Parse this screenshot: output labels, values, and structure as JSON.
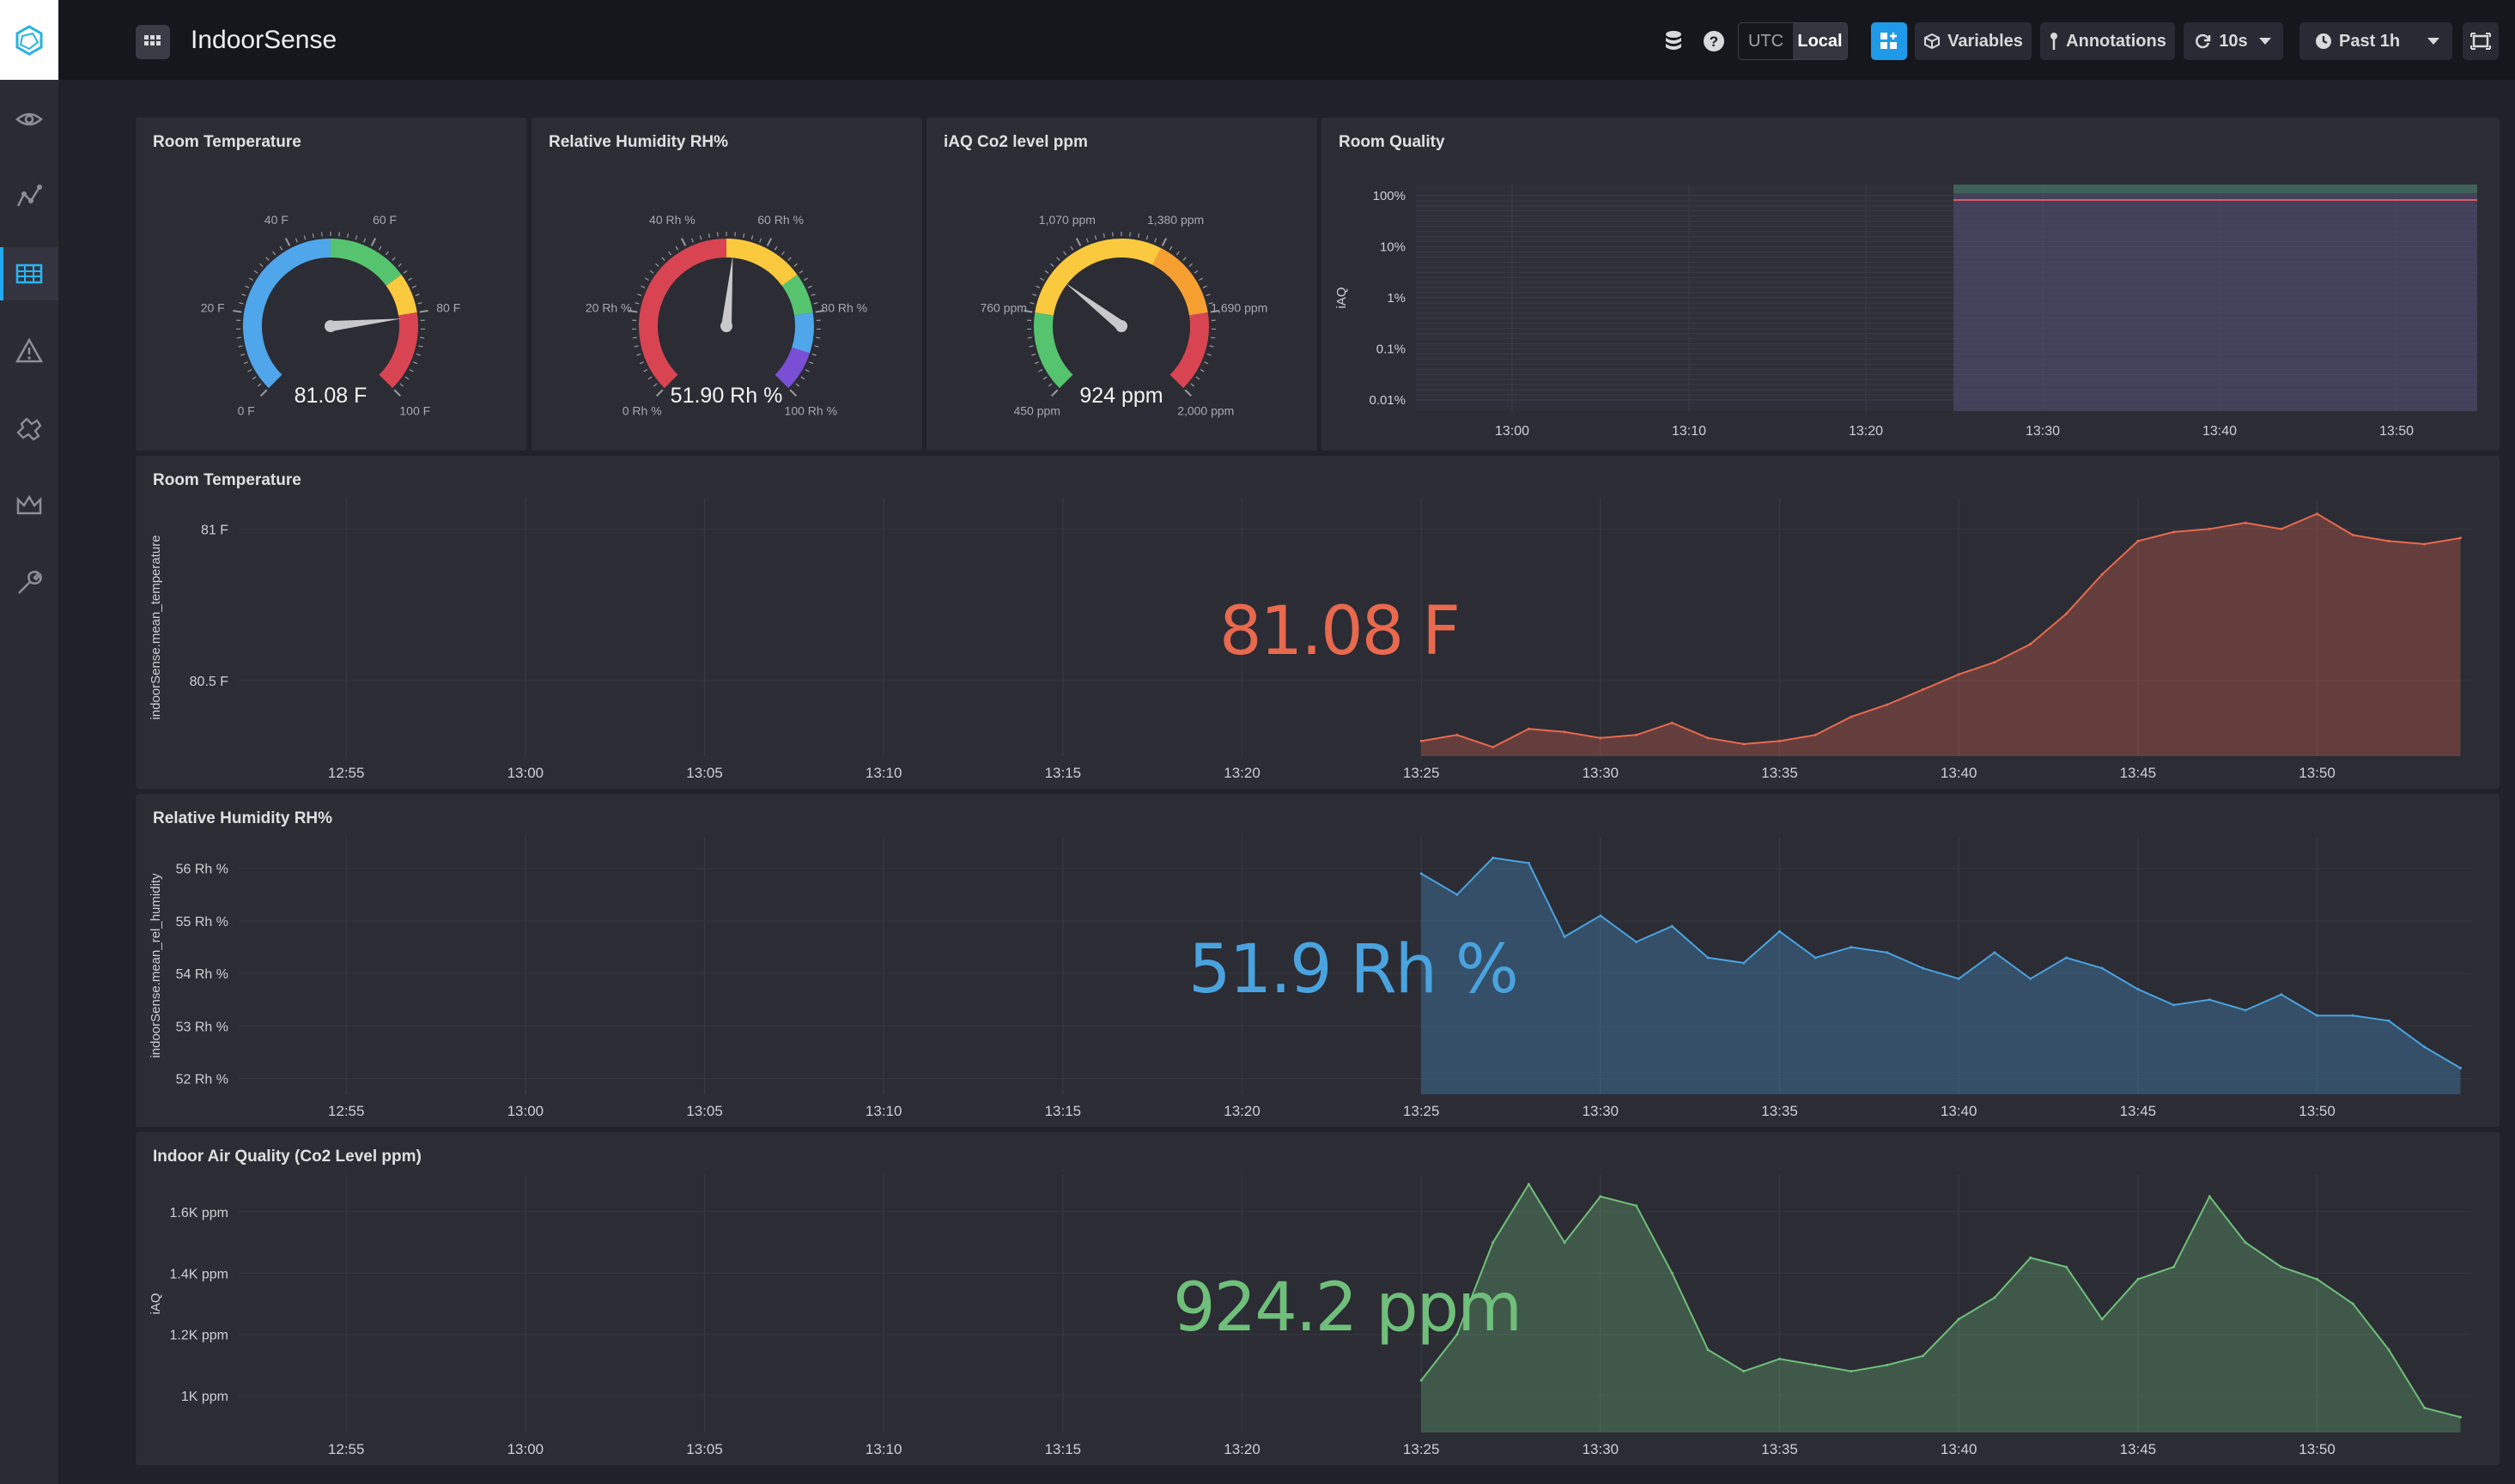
{
  "app": {
    "title": "IndoorSense"
  },
  "toolbar": {
    "utc": "UTC",
    "local": "Local",
    "variables": "Variables",
    "annotations": "Annotations",
    "refresh": "10s",
    "time_range": "Past 1h"
  },
  "sidebar": {
    "items": [
      {
        "icon": "eye-icon"
      },
      {
        "icon": "graph-icon"
      },
      {
        "icon": "dashboard-grid-icon",
        "active": true
      },
      {
        "icon": "alert-icon"
      },
      {
        "icon": "plugins-icon"
      },
      {
        "icon": "crown-icon"
      },
      {
        "icon": "wrench-icon"
      }
    ]
  },
  "colors": {
    "green": "#56c46f",
    "blue": "#4fa6ea",
    "yellow": "#fbc93d",
    "orange": "#f6a032",
    "red": "#d94452",
    "purple": "#7a4fd6",
    "temp_series": "#e8694e",
    "hum_series": "#4aa3df",
    "iaq_series": "#6fbf7a"
  },
  "gauges": [
    {
      "title": "Room Temperature",
      "value": "81.08 F",
      "min": 0,
      "max": 100,
      "needle": 81.08,
      "ticks": [
        "0 F",
        "20 F",
        "40 F",
        "60 F",
        "80 F",
        "100 F"
      ],
      "bands": [
        {
          "to": 50,
          "color": "#4fa6ea"
        },
        {
          "to": 70,
          "color": "#56c46f"
        },
        {
          "to": 80,
          "color": "#fbc93d"
        },
        {
          "to": 100,
          "color": "#d94452"
        }
      ]
    },
    {
      "title": "Relative Humidity RH%",
      "value": "51.90 Rh %",
      "min": 0,
      "max": 100,
      "needle": 51.9,
      "ticks": [
        "0 Rh %",
        "20 Rh %",
        "40 Rh %",
        "60 Rh %",
        "80 Rh %",
        "100 Rh %"
      ],
      "bands": [
        {
          "to": 50,
          "color": "#d94452"
        },
        {
          "to": 70,
          "color": "#fbc93d"
        },
        {
          "to": 80,
          "color": "#56c46f"
        },
        {
          "to": 90,
          "color": "#4fa6ea"
        },
        {
          "to": 100,
          "color": "#7a4fd6"
        }
      ]
    },
    {
      "title": "iAQ Co2 level ppm",
      "value": "924 ppm",
      "min": 450,
      "max": 2000,
      "needle": 924,
      "ticks": [
        "450 ppm",
        "760 ppm",
        "1,070 ppm",
        "1,380 ppm",
        "1,690 ppm",
        "2,000 ppm"
      ],
      "bands": [
        {
          "to": 760,
          "color": "#56c46f"
        },
        {
          "to": 1380,
          "color": "#fbc93d"
        },
        {
          "to": 1690,
          "color": "#f6a032"
        },
        {
          "to": 2000,
          "color": "#d94452"
        }
      ]
    }
  ],
  "room_quality": {
    "title": "Room Quality",
    "ylabel": "iAQ",
    "yticks": [
      "100%",
      "10%",
      "1%",
      "0.1%",
      "0.01%"
    ],
    "xticks": [
      "13:00",
      "13:10",
      "13:20",
      "13:30",
      "13:40",
      "13:50"
    ]
  },
  "chart_data": [
    {
      "type": "area",
      "title": "Room Temperature",
      "ylabel": "indoorSense.mean_temperature",
      "yticks": [
        "81 F",
        "80.5 F"
      ],
      "xticks": [
        "12:55",
        "13:00",
        "13:05",
        "13:10",
        "13:15",
        "13:20",
        "13:25",
        "13:30",
        "13:35",
        "13:40",
        "13:45",
        "13:50"
      ],
      "big_value": "81.08 F",
      "x": [
        "13:25",
        "13:26",
        "13:27",
        "13:28",
        "13:29",
        "13:30",
        "13:31",
        "13:32",
        "13:33",
        "13:34",
        "13:35",
        "13:36",
        "13:37",
        "13:38",
        "13:39",
        "13:40",
        "13:41",
        "13:42",
        "13:43",
        "13:44",
        "13:45",
        "13:46",
        "13:47",
        "13:48",
        "13:49",
        "13:50",
        "13:51",
        "13:52",
        "13:53",
        "13:54"
      ],
      "values": [
        80.3,
        80.32,
        80.28,
        80.34,
        80.33,
        80.31,
        80.32,
        80.36,
        80.31,
        80.29,
        80.3,
        80.32,
        80.38,
        80.42,
        80.47,
        80.52,
        80.56,
        80.62,
        80.72,
        80.85,
        80.96,
        80.99,
        81.0,
        81.02,
        81.0,
        81.05,
        80.98,
        80.96,
        80.95,
        80.97
      ],
      "ylim": [
        80.25,
        81.1
      ]
    },
    {
      "type": "area",
      "title": "Relative Humidity RH%",
      "ylabel": "indoorSense.mean_rel_humidity",
      "yticks": [
        "56 Rh %",
        "55 Rh %",
        "54 Rh %",
        "53 Rh %",
        "52 Rh %"
      ],
      "xticks": [
        "12:55",
        "13:00",
        "13:05",
        "13:10",
        "13:15",
        "13:20",
        "13:25",
        "13:30",
        "13:35",
        "13:40",
        "13:45",
        "13:50"
      ],
      "big_value": "51.9 Rh %",
      "x": [
        "13:25",
        "13:26",
        "13:27",
        "13:28",
        "13:29",
        "13:30",
        "13:31",
        "13:32",
        "13:33",
        "13:34",
        "13:35",
        "13:36",
        "13:37",
        "13:38",
        "13:39",
        "13:40",
        "13:41",
        "13:42",
        "13:43",
        "13:44",
        "13:45",
        "13:46",
        "13:47",
        "13:48",
        "13:49",
        "13:50",
        "13:51",
        "13:52",
        "13:53",
        "13:54"
      ],
      "values": [
        55.9,
        55.5,
        56.2,
        56.1,
        54.7,
        55.1,
        54.6,
        54.9,
        54.3,
        54.2,
        54.8,
        54.3,
        54.5,
        54.4,
        54.1,
        53.9,
        54.4,
        53.9,
        54.3,
        54.1,
        53.7,
        53.4,
        53.5,
        53.3,
        53.6,
        53.2,
        53.2,
        53.1,
        52.6,
        52.2
      ],
      "ylim": [
        51.7,
        56.6
      ]
    },
    {
      "type": "area",
      "title": "Indoor Air Quality (Co2 Level ppm)",
      "ylabel": "iAQ",
      "yticks": [
        "1.6K ppm",
        "1.4K ppm",
        "1.2K ppm",
        "1K ppm"
      ],
      "xticks": [
        "12:55",
        "13:00",
        "13:05",
        "13:10",
        "13:15",
        "13:20",
        "13:25",
        "13:30",
        "13:35",
        "13:40",
        "13:45",
        "13:50"
      ],
      "big_value": "924.2 ppm",
      "x": [
        "13:25",
        "13:26",
        "13:27",
        "13:28",
        "13:29",
        "13:30",
        "13:31",
        "13:32",
        "13:33",
        "13:34",
        "13:35",
        "13:36",
        "13:37",
        "13:38",
        "13:39",
        "13:40",
        "13:41",
        "13:42",
        "13:43",
        "13:44",
        "13:45",
        "13:46",
        "13:47",
        "13:48",
        "13:49",
        "13:50",
        "13:51",
        "13:52",
        "13:53",
        "13:54"
      ],
      "values": [
        1050,
        1200,
        1500,
        1690,
        1500,
        1650,
        1620,
        1400,
        1150,
        1080,
        1120,
        1100,
        1080,
        1100,
        1130,
        1250,
        1320,
        1450,
        1420,
        1250,
        1380,
        1420,
        1650,
        1500,
        1420,
        1380,
        1300,
        1150,
        960,
        930
      ],
      "ylim": [
        880,
        1720
      ]
    }
  ]
}
